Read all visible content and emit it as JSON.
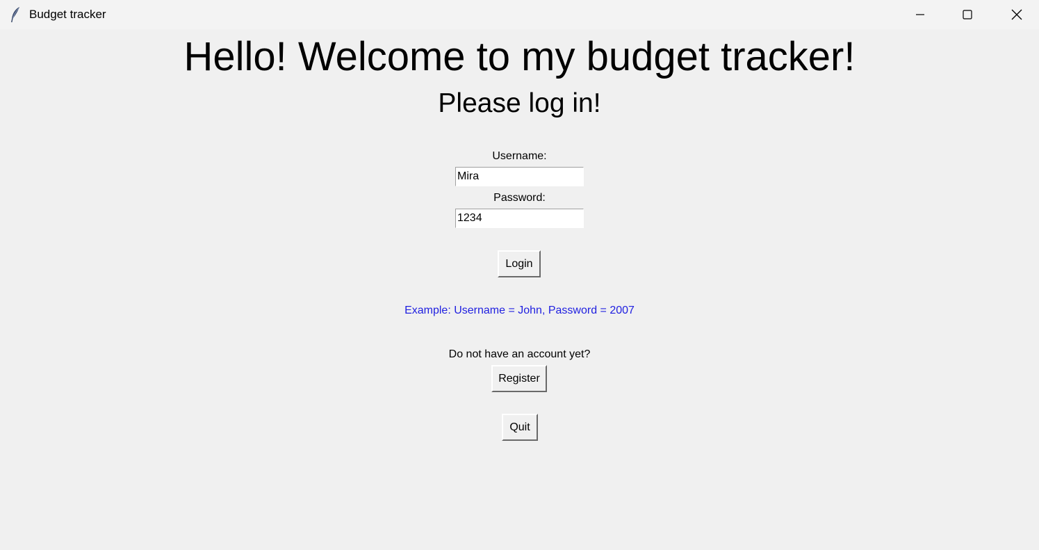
{
  "window": {
    "title": "Budget tracker",
    "icon": "feather-icon",
    "controls": [
      "minimize-icon",
      "maximize-icon",
      "close-icon"
    ]
  },
  "main": {
    "heading": "Hello! Welcome to my budget tracker!",
    "subheading": "Please log in!",
    "username_label": "Username:",
    "username_value": "Mira",
    "password_label": "Password:",
    "password_value": "1234",
    "login_label": "Login",
    "example_text": "Example: Username = John, Password = 2007",
    "no_account_text": "Do not have an account yet?",
    "register_label": "Register",
    "quit_label": "Quit"
  },
  "colors": {
    "background": "#f0f0f0",
    "example_text": "#2020e0"
  }
}
